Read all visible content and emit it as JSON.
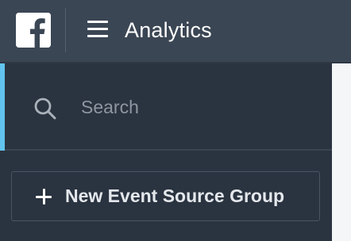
{
  "header": {
    "logo_icon": "facebook-f-icon",
    "menu_icon": "hamburger-menu-icon",
    "title": "Analytics"
  },
  "sidebar": {
    "search": {
      "icon": "search-icon",
      "placeholder": "Search",
      "value": ""
    },
    "new_group_button": {
      "icon": "plus-icon",
      "label": "New Event Source Group"
    }
  },
  "colors": {
    "header_bg": "#3b4654",
    "sidebar_bg": "#2a3340",
    "accent": "#62c4ee",
    "text_primary": "#ffffff",
    "placeholder": "#8e979f"
  }
}
